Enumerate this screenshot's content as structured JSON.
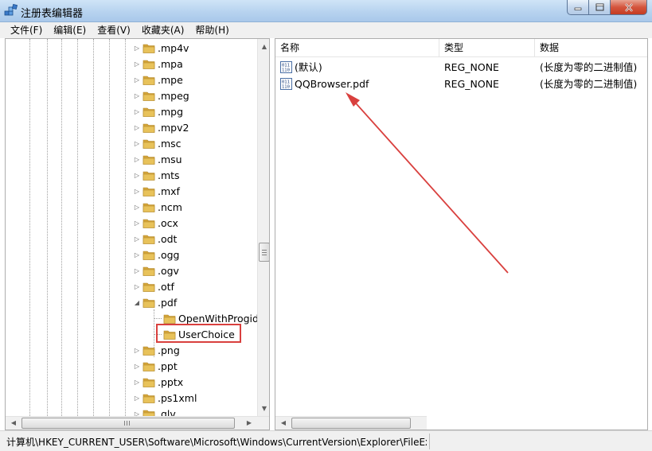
{
  "window": {
    "title": "注册表编辑器"
  },
  "menu": [
    {
      "label": "文件(F)"
    },
    {
      "label": "编辑(E)"
    },
    {
      "label": "查看(V)"
    },
    {
      "label": "收藏夹(A)"
    },
    {
      "label": "帮助(H)"
    }
  ],
  "tree": {
    "items": [
      {
        "label": ".mp4v",
        "expander": "▷",
        "level": 0
      },
      {
        "label": ".mpa",
        "expander": "▷",
        "level": 0
      },
      {
        "label": ".mpe",
        "expander": "▷",
        "level": 0
      },
      {
        "label": ".mpeg",
        "expander": "▷",
        "level": 0
      },
      {
        "label": ".mpg",
        "expander": "▷",
        "level": 0
      },
      {
        "label": ".mpv2",
        "expander": "▷",
        "level": 0
      },
      {
        "label": ".msc",
        "expander": "▷",
        "level": 0
      },
      {
        "label": ".msu",
        "expander": "▷",
        "level": 0
      },
      {
        "label": ".mts",
        "expander": "▷",
        "level": 0
      },
      {
        "label": ".mxf",
        "expander": "▷",
        "level": 0
      },
      {
        "label": ".ncm",
        "expander": "▷",
        "level": 0
      },
      {
        "label": ".ocx",
        "expander": "▷",
        "level": 0
      },
      {
        "label": ".odt",
        "expander": "▷",
        "level": 0
      },
      {
        "label": ".ogg",
        "expander": "▷",
        "level": 0
      },
      {
        "label": ".ogv",
        "expander": "▷",
        "level": 0
      },
      {
        "label": ".otf",
        "expander": "▷",
        "level": 0
      },
      {
        "label": ".pdf",
        "expander": "◢",
        "level": 0
      },
      {
        "label": "OpenWithProgids",
        "expander": "",
        "level": 1
      },
      {
        "label": "UserChoice",
        "expander": "",
        "level": 1
      },
      {
        "label": ".png",
        "expander": "▷",
        "level": 0
      },
      {
        "label": ".ppt",
        "expander": "▷",
        "level": 0
      },
      {
        "label": ".pptx",
        "expander": "▷",
        "level": 0
      },
      {
        "label": ".ps1xml",
        "expander": "▷",
        "level": 0
      },
      {
        "label": ".qlv",
        "expander": "▷",
        "level": 0
      }
    ]
  },
  "list": {
    "columns": [
      "名称",
      "类型",
      "数据"
    ],
    "rows": [
      {
        "name": "(默认)",
        "type": "REG_NONE",
        "data": "(长度为零的二进制值)"
      },
      {
        "name": "QQBrowser.pdf",
        "type": "REG_NONE",
        "data": "(长度为零的二进制值)"
      }
    ]
  },
  "status": {
    "path": "计算机\\HKEY_CURRENT_USER\\Software\\Microsoft\\Windows\\CurrentVersion\\Explorer\\FileExts\\.pdf\\UserChoice"
  },
  "colors": {
    "annotation_red": "#d9403e",
    "folder_yellow": "#e8c25a"
  }
}
